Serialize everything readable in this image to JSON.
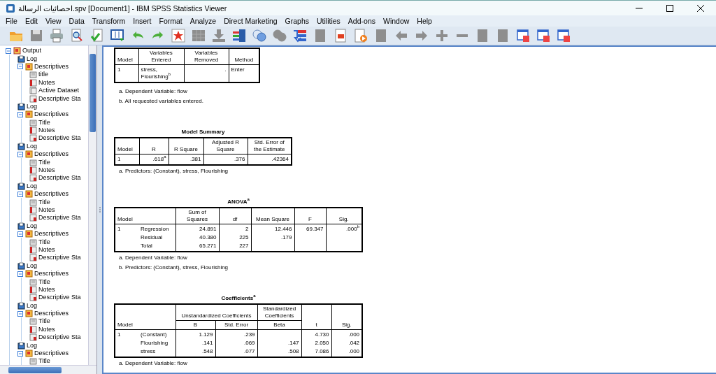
{
  "window": {
    "title": "احصائيات الرسالة.spv [Document1] - IBM SPSS Statistics Viewer"
  },
  "menu": [
    "File",
    "Edit",
    "View",
    "Data",
    "Transform",
    "Insert",
    "Format",
    "Analyze",
    "Direct Marketing",
    "Graphs",
    "Utilities",
    "Add-ons",
    "Window",
    "Help"
  ],
  "toolbar": [
    {
      "kind": "open",
      "disabled": false
    },
    {
      "kind": "save",
      "disabled": true
    },
    {
      "kind": "print",
      "disabled": false
    },
    {
      "kind": "preview",
      "disabled": false
    },
    {
      "kind": "export",
      "disabled": false
    },
    {
      "kind": "data",
      "disabled": false
    },
    {
      "kind": "undo",
      "disabled": false
    },
    {
      "kind": "redo",
      "disabled": false
    },
    {
      "kind": "chart",
      "disabled": false
    },
    {
      "kind": "grid",
      "disabled": true
    },
    {
      "kind": "import",
      "disabled": true
    },
    {
      "kind": "variables",
      "disabled": false
    },
    {
      "kind": "circles",
      "disabled": false
    },
    {
      "kind": "circles",
      "disabled": true
    },
    {
      "kind": "select",
      "disabled": false
    },
    {
      "kind": "doc",
      "disabled": true
    },
    {
      "kind": "chartdoc",
      "disabled": false
    },
    {
      "kind": "script",
      "disabled": false
    },
    {
      "kind": "doc",
      "disabled": true
    },
    {
      "kind": "back",
      "disabled": true
    },
    {
      "kind": "forward",
      "disabled": true
    },
    {
      "kind": "plus",
      "disabled": true
    },
    {
      "kind": "minus",
      "disabled": true
    },
    {
      "kind": "doc",
      "disabled": true
    },
    {
      "kind": "doc",
      "disabled": true
    },
    {
      "kind": "window",
      "disabled": false
    },
    {
      "kind": "window",
      "disabled": false
    },
    {
      "kind": "window",
      "disabled": false
    }
  ],
  "outline": {
    "label": "Output",
    "kind": "output",
    "expanded": true,
    "children": [
      {
        "label": "Log",
        "kind": "log"
      },
      {
        "label": "Descriptives",
        "kind": "procedure",
        "expanded": true,
        "children": [
          {
            "label": "title",
            "kind": "title"
          },
          {
            "label": "Notes",
            "kind": "notes"
          },
          {
            "label": "Active Dataset",
            "kind": "dataset"
          },
          {
            "label": "Descriptive Sta",
            "kind": "table"
          }
        ]
      },
      {
        "label": "Log",
        "kind": "log"
      },
      {
        "label": "Descriptives",
        "kind": "procedure",
        "expanded": true,
        "children": [
          {
            "label": "Title",
            "kind": "title"
          },
          {
            "label": "Notes",
            "kind": "notes"
          },
          {
            "label": "Descriptive Sta",
            "kind": "table"
          }
        ]
      },
      {
        "label": "Log",
        "kind": "log"
      },
      {
        "label": "Descriptives",
        "kind": "procedure",
        "expanded": true,
        "children": [
          {
            "label": "Title",
            "kind": "title"
          },
          {
            "label": "Notes",
            "kind": "notes"
          },
          {
            "label": "Descriptive Sta",
            "kind": "table"
          }
        ]
      },
      {
        "label": "Log",
        "kind": "log"
      },
      {
        "label": "Descriptives",
        "kind": "procedure",
        "expanded": true,
        "children": [
          {
            "label": "Title",
            "kind": "title"
          },
          {
            "label": "Notes",
            "kind": "notes"
          },
          {
            "label": "Descriptive Sta",
            "kind": "table"
          }
        ]
      },
      {
        "label": "Log",
        "kind": "log"
      },
      {
        "label": "Descriptives",
        "kind": "procedure",
        "expanded": true,
        "children": [
          {
            "label": "Title",
            "kind": "title"
          },
          {
            "label": "Notes",
            "kind": "notes"
          },
          {
            "label": "Descriptive Sta",
            "kind": "table"
          }
        ]
      },
      {
        "label": "Log",
        "kind": "log"
      },
      {
        "label": "Descriptives",
        "kind": "procedure",
        "expanded": true,
        "children": [
          {
            "label": "Title",
            "kind": "title"
          },
          {
            "label": "Notes",
            "kind": "notes"
          },
          {
            "label": "Descriptive Sta",
            "kind": "table"
          }
        ]
      },
      {
        "label": "Log",
        "kind": "log"
      },
      {
        "label": "Descriptives",
        "kind": "procedure",
        "expanded": true,
        "children": [
          {
            "label": "Title",
            "kind": "title"
          },
          {
            "label": "Notes",
            "kind": "notes"
          },
          {
            "label": "Descriptive Sta",
            "kind": "table"
          }
        ]
      },
      {
        "label": "Log",
        "kind": "log"
      },
      {
        "label": "Descriptives",
        "kind": "procedure",
        "expanded": true,
        "children": [
          {
            "label": "Title",
            "kind": "title"
          }
        ]
      }
    ]
  },
  "tables": [
    {
      "header_rows": [
        [
          {
            "text": "Model"
          },
          {
            "text": "Variables Entered"
          },
          {
            "text": "Variables Removed"
          },
          {
            "text": "Method"
          }
        ]
      ],
      "kind": "variables",
      "rows": [
        [
          "1",
          "stress, Flourishing$^{b}$",
          ".",
          "Enter"
        ]
      ],
      "footnotes": [
        "a. Dependent Variable: flow",
        "b. All requested variables entered."
      ]
    },
    {
      "title": "Model Summary",
      "header_rows": [
        [
          {
            "text": "Model"
          },
          {
            "text": "R"
          },
          {
            "text": "R Square"
          },
          {
            "text": "Adjusted R Square"
          },
          {
            "text": "Std. Error of the Estimate"
          }
        ]
      ],
      "kind": "statistics",
      "rows": [
        [
          "1",
          ".618$^{a}$",
          ".381",
          ".376",
          ".42364"
        ]
      ],
      "footnotes": [
        "a. Predictors: (Constant), stress, Flourishing"
      ]
    },
    {
      "title": "ANOVA$^{a}$",
      "header_rows": [
        [
          {
            "text": "Model",
            "colspan": 2
          },
          {
            "text": "Sum of Squares"
          },
          {
            "text": "df"
          },
          {
            "text": "Mean Square"
          },
          {
            "text": "F"
          },
          {
            "text": "Sig."
          }
        ]
      ],
      "kind": "statistics",
      "rows": [
        [
          "1",
          "Regression",
          "24.891",
          "2",
          "12.446",
          "69.347",
          ".000$^{b}$"
        ],
        [
          null,
          "Residual",
          "40.380",
          "225",
          ".179",
          null,
          null
        ],
        [
          null,
          "Total",
          "65.271",
          "227",
          null,
          null,
          null
        ]
      ],
      "footnotes": [
        "a. Dependent Variable: flow",
        "b. Predictors: (Constant), stress, Flourishing"
      ]
    },
    {
      "title": "Coefficients$^{a}$",
      "header_rows": [
        [
          {
            "text": "Model",
            "colspan": 2,
            "rowspan": 2
          },
          {
            "text": "Unstandardized Coefficients",
            "colspan": 2
          },
          {
            "text": "Standardized Coefficients"
          },
          {
            "text": "t",
            "rowspan": 2
          },
          {
            "text": "Sig.",
            "rowspan": 2
          }
        ],
        [
          {
            "text": "B"
          },
          {
            "text": "Std. Error"
          },
          {
            "text": "Beta"
          }
        ]
      ],
      "kind": "statistics",
      "rows": [
        [
          "1",
          "(Constant)",
          "1.129",
          ".239",
          null,
          "4.730",
          ".000"
        ],
        [
          null,
          "Flourishing",
          ".141",
          ".069",
          ".147",
          "2.050",
          ".042"
        ],
        [
          null,
          "stress",
          ".548",
          ".077",
          ".508",
          "7.086",
          ".000"
        ]
      ],
      "footnotes": [
        "a. Dependent Variable: flow"
      ]
    }
  ]
}
